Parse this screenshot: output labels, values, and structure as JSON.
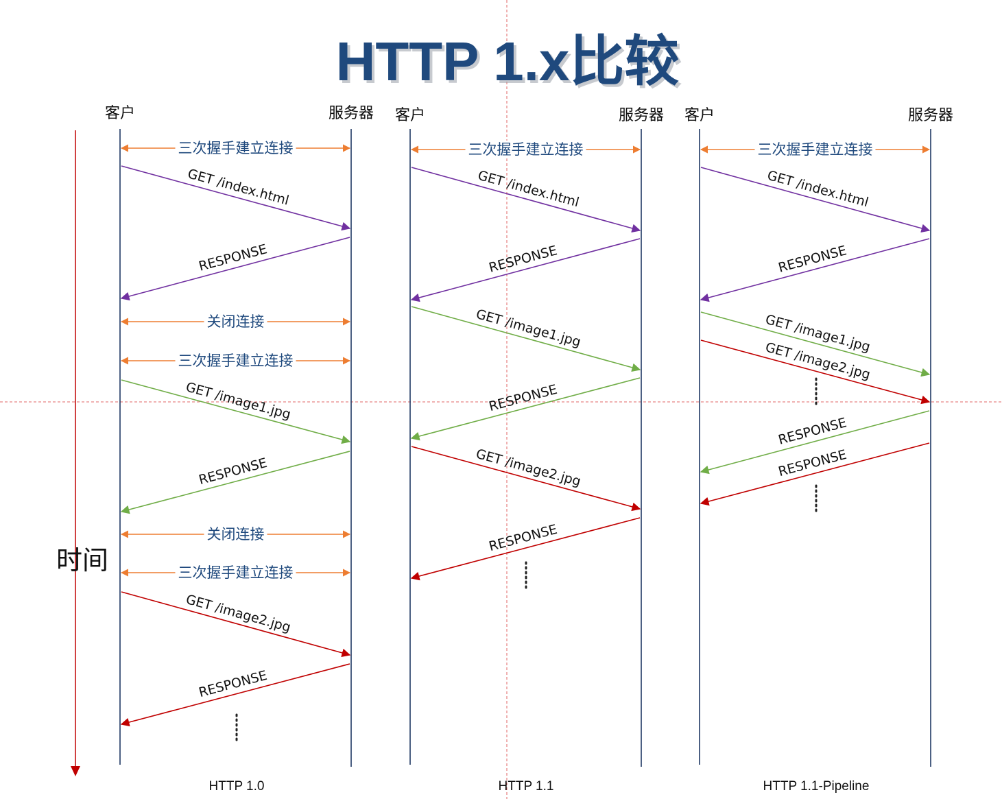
{
  "title": "HTTP 1.x比较",
  "time_axis_label": "时间",
  "colors": {
    "title": "#1F497D",
    "lifeline": "#1F3864",
    "handshake": "#ED7D31",
    "handshake_text": "#1F497D",
    "index_request": "#7030A0",
    "image1_request": "#70AD47",
    "image2_request": "#C00000",
    "time_axis": "#C00000",
    "guide_line": "#E06666"
  },
  "panels": [
    {
      "protocol": "HTTP 1.0",
      "client_label": "客户",
      "server_label": "服务器",
      "messages": [
        {
          "kind": "handshake",
          "label": "三次握手建立连接"
        },
        {
          "kind": "request",
          "label": "GET /index.html",
          "color": "index_request"
        },
        {
          "kind": "response",
          "label": "RESPONSE",
          "color": "index_request"
        },
        {
          "kind": "handshake",
          "label": "关闭连接"
        },
        {
          "kind": "handshake",
          "label": "三次握手建立连接"
        },
        {
          "kind": "request",
          "label": "GET /image1.jpg",
          "color": "image1_request"
        },
        {
          "kind": "response",
          "label": "RESPONSE",
          "color": "image1_request"
        },
        {
          "kind": "handshake",
          "label": "关闭连接"
        },
        {
          "kind": "handshake",
          "label": "三次握手建立连接"
        },
        {
          "kind": "request",
          "label": "GET /image2.jpg",
          "color": "image2_request"
        },
        {
          "kind": "response",
          "label": "RESPONSE",
          "color": "image2_request"
        }
      ]
    },
    {
      "protocol": "HTTP 1.1",
      "client_label": "客户",
      "server_label": "服务器",
      "messages": [
        {
          "kind": "handshake",
          "label": "三次握手建立连接"
        },
        {
          "kind": "request",
          "label": "GET /index.html",
          "color": "index_request"
        },
        {
          "kind": "response",
          "label": "RESPONSE",
          "color": "index_request"
        },
        {
          "kind": "request",
          "label": "GET /image1.jpg",
          "color": "image1_request"
        },
        {
          "kind": "response",
          "label": "RESPONSE",
          "color": "image1_request"
        },
        {
          "kind": "request",
          "label": "GET /image2.jpg",
          "color": "image2_request"
        },
        {
          "kind": "response",
          "label": "RESPONSE",
          "color": "image2_request"
        }
      ]
    },
    {
      "protocol": "HTTP 1.1-Pipeline",
      "client_label": "客户",
      "server_label": "服务器",
      "messages": [
        {
          "kind": "handshake",
          "label": "三次握手建立连接"
        },
        {
          "kind": "request",
          "label": "GET /index.html",
          "color": "index_request"
        },
        {
          "kind": "response",
          "label": "RESPONSE",
          "color": "index_request"
        },
        {
          "kind": "request",
          "label": "GET /image1.jpg",
          "color": "image1_request"
        },
        {
          "kind": "request",
          "label": "GET /image2.jpg",
          "color": "image2_request"
        },
        {
          "kind": "response",
          "label": "RESPONSE",
          "color": "image1_request"
        },
        {
          "kind": "response",
          "label": "RESPONSE",
          "color": "image2_request"
        }
      ]
    }
  ]
}
